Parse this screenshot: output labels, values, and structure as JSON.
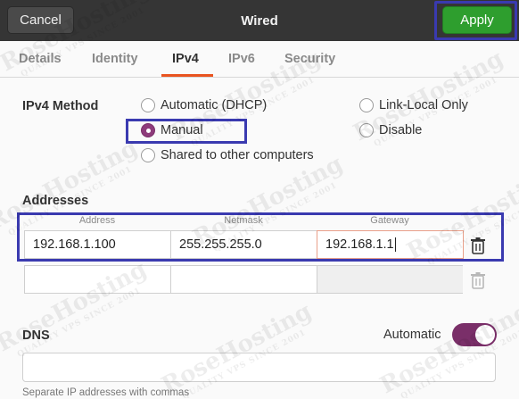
{
  "window": {
    "title": "Wired"
  },
  "header": {
    "cancel_label": "Cancel",
    "apply_label": "Apply"
  },
  "tabs": [
    {
      "label": "Details"
    },
    {
      "label": "Identity"
    },
    {
      "label": "IPv4",
      "active": true
    },
    {
      "label": "IPv6"
    },
    {
      "label": "Security"
    }
  ],
  "ipv4": {
    "method_label": "IPv4 Method",
    "options": {
      "automatic": "Automatic (DHCP)",
      "link_local": "Link-Local Only",
      "manual": "Manual",
      "disable": "Disable",
      "shared": "Shared to other computers"
    },
    "selected": "Manual"
  },
  "addresses": {
    "label": "Addresses",
    "columns": [
      "Address",
      "Netmask",
      "Gateway"
    ],
    "rows": [
      [
        "192.168.1.100",
        "255.255.255.0",
        "192.168.1.1"
      ],
      [
        "",
        "",
        ""
      ]
    ]
  },
  "dns": {
    "label": "DNS",
    "automatic_label": "Automatic",
    "automatic_on": true,
    "value": "",
    "hint": "Separate IP addresses with commas"
  },
  "colors": {
    "accent": "#e95420",
    "apply": "#2e9e2e",
    "toggle": "#7a2f69",
    "highlight": "#3a3ab0"
  },
  "watermark": {
    "text": "RoseHosting",
    "sub": "QUALITY VPS SINCE 2001"
  }
}
